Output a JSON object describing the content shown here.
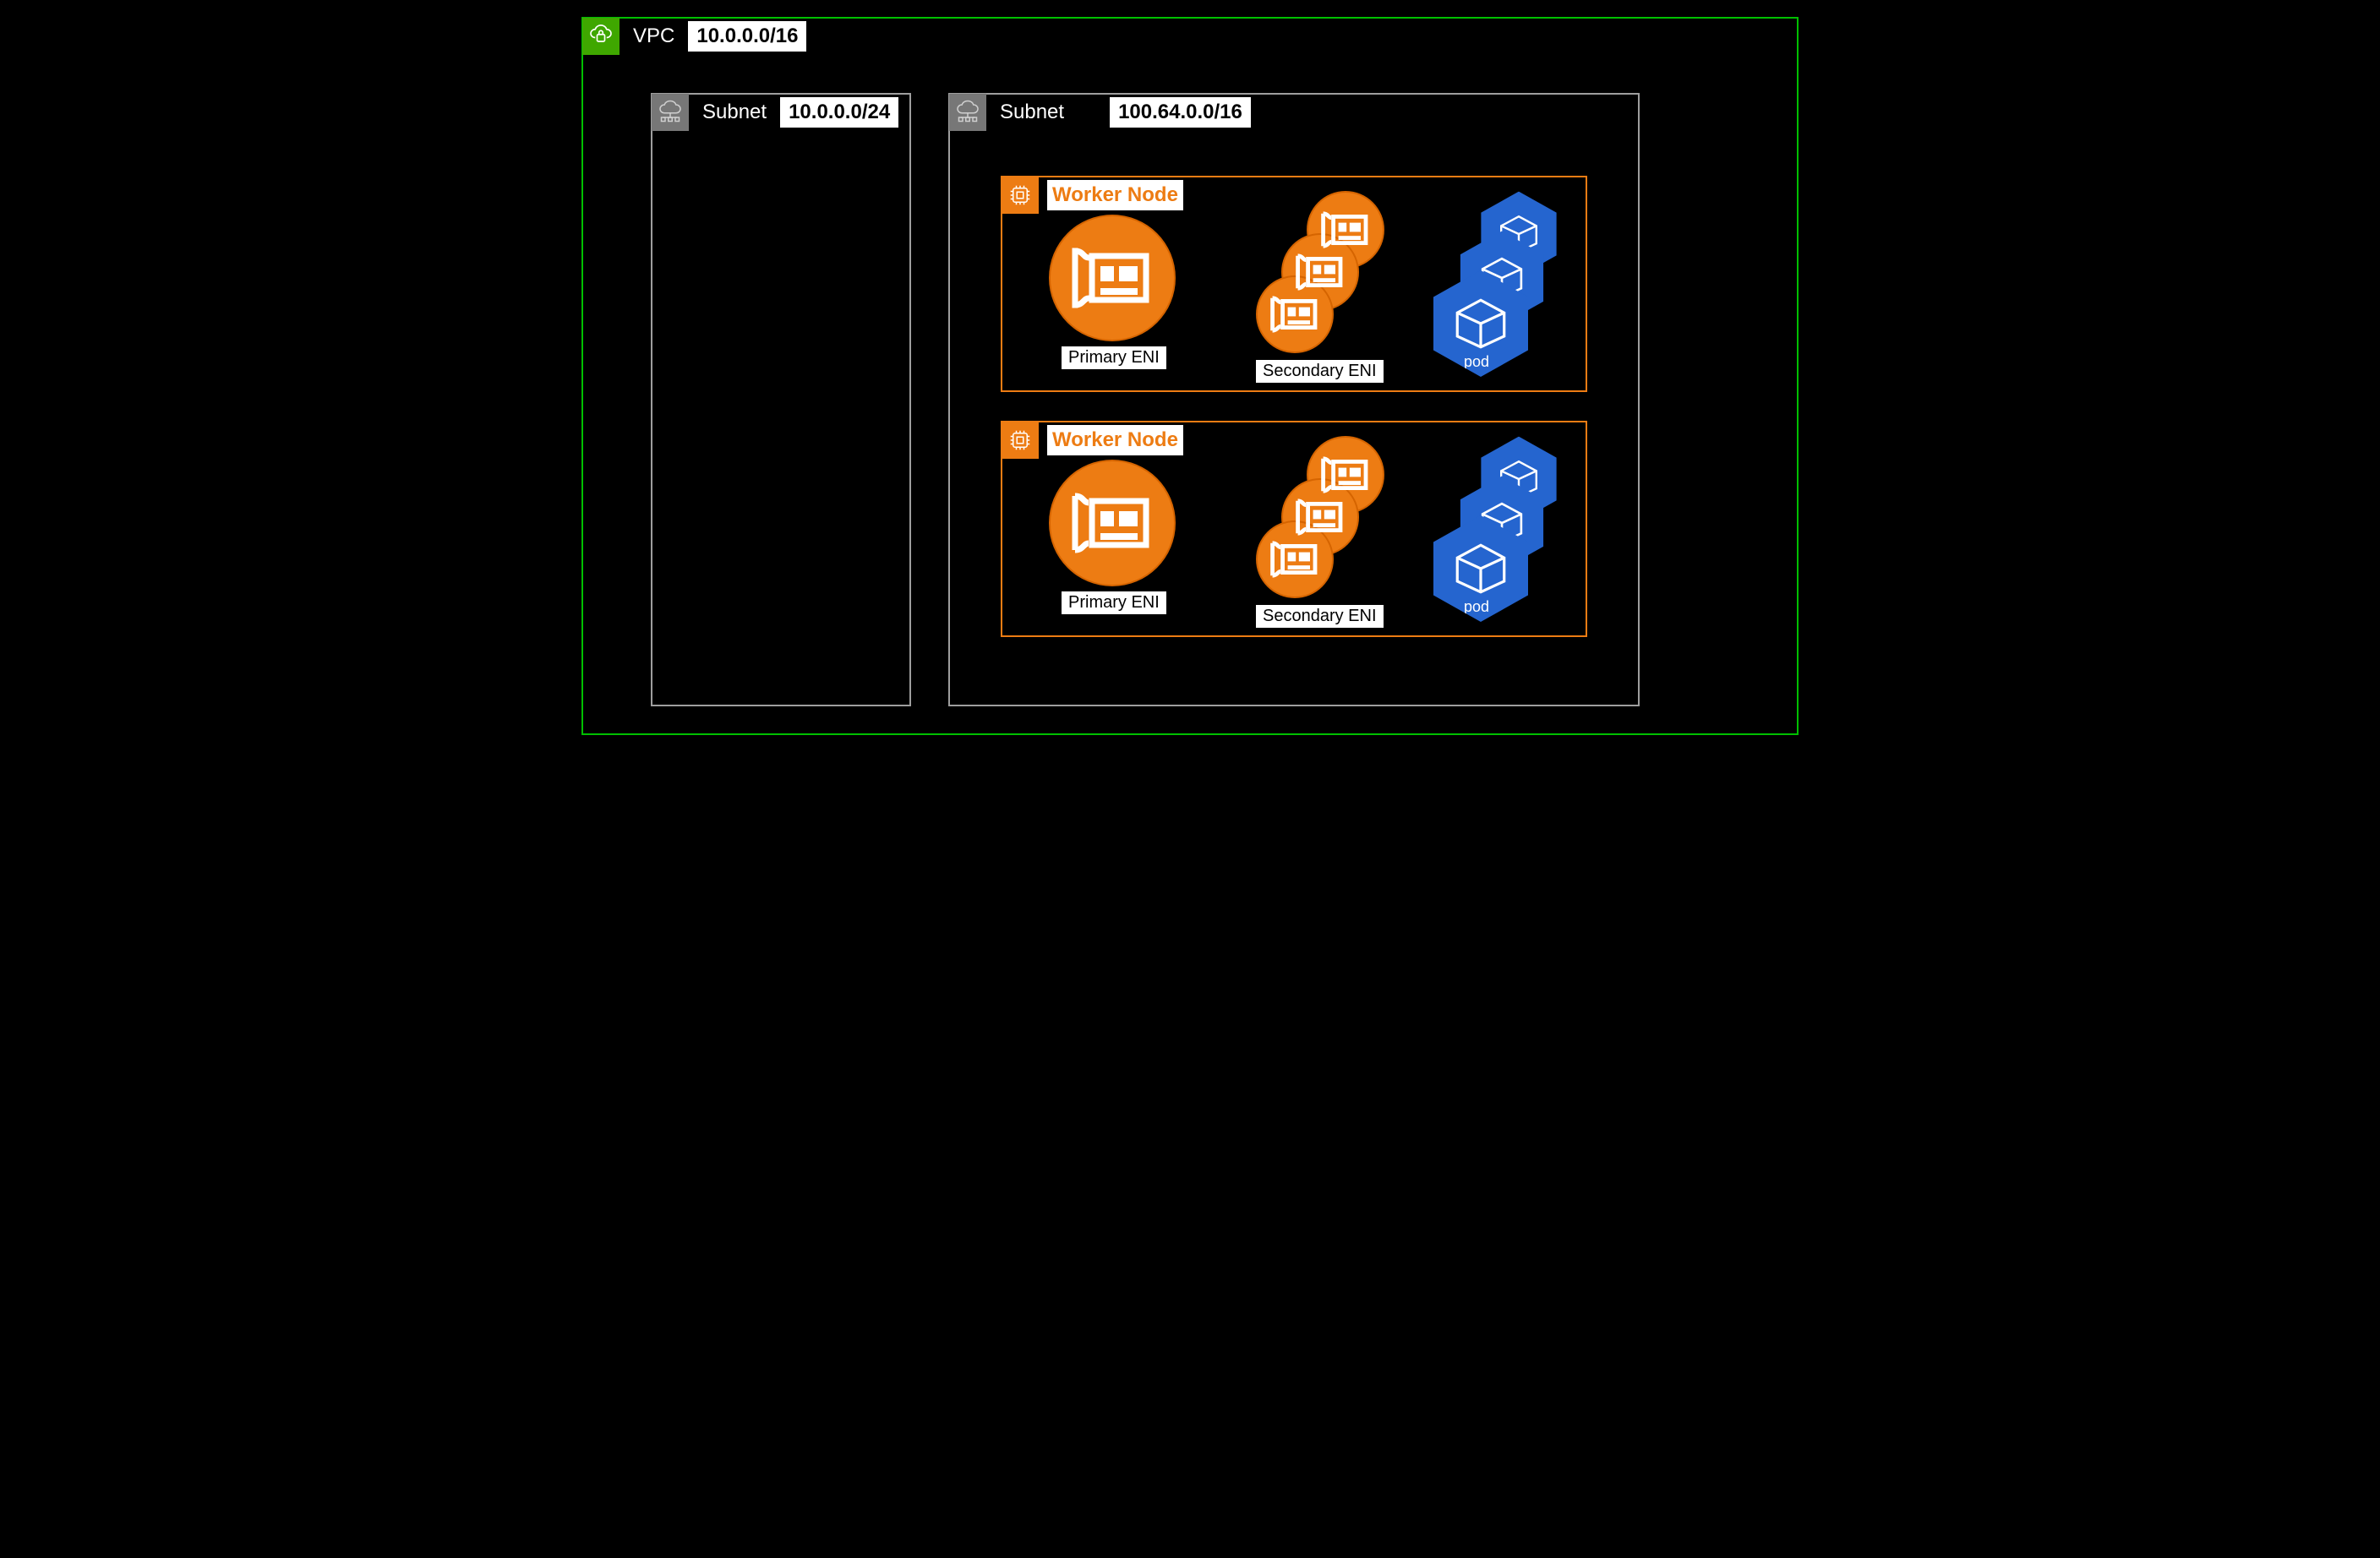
{
  "vpc": {
    "title": "VPC",
    "cidr": "10.0.0.0/16"
  },
  "subnets": [
    {
      "title": "Subnet",
      "cidr": "10.0.0.0/24"
    },
    {
      "title": "Subnet",
      "cidr": "100.64.0.0/16"
    }
  ],
  "workerNode": {
    "title": "Worker Node",
    "primaryLabel": "Primary ENI",
    "secondaryLabel": "Secondary ENI",
    "podLabel": "pod"
  }
}
